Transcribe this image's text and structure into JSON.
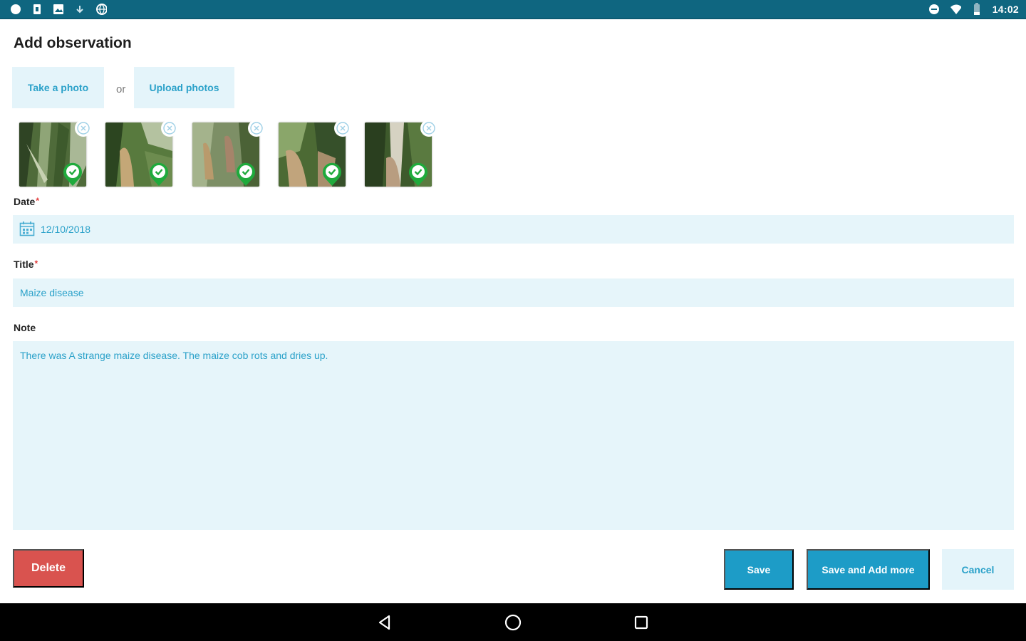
{
  "status_bar": {
    "time": "14:02",
    "left_icons": [
      "circle-icon",
      "sim-icon",
      "image-icon",
      "download-icon",
      "globe-icon"
    ],
    "right_icons": [
      "dnd-icon",
      "wifi-icon",
      "battery-icon"
    ]
  },
  "page": {
    "title": "Add observation"
  },
  "photo_actions": {
    "take_photo_label": "Take a photo",
    "or_text": "or",
    "upload_label": "Upload photos"
  },
  "photos": [
    {
      "name": "photo-1",
      "status": "located"
    },
    {
      "name": "photo-2",
      "status": "located"
    },
    {
      "name": "photo-3",
      "status": "located"
    },
    {
      "name": "photo-4",
      "status": "located"
    },
    {
      "name": "photo-5",
      "status": "located"
    }
  ],
  "form": {
    "date_label": "Date",
    "date_value": "12/10/2018",
    "title_label": "Title",
    "title_value": "Maize disease",
    "note_label": "Note",
    "note_value": "There was A strange maize disease. The maize cob rots and dries up.",
    "required_mark": "*"
  },
  "actions": {
    "delete_label": "Delete",
    "save_label": "Save",
    "save_add_label": "Save and Add more",
    "cancel_label": "Cancel"
  },
  "colors": {
    "status_bar": "#0f6680",
    "accent": "#1d9cc7",
    "field_bg": "#e6f5fa",
    "danger": "#d9534f",
    "required": "#e23b3b",
    "pin_green": "#1faa3c"
  },
  "nav_bar": {
    "icons": [
      "back-icon",
      "home-icon",
      "recents-icon"
    ]
  }
}
